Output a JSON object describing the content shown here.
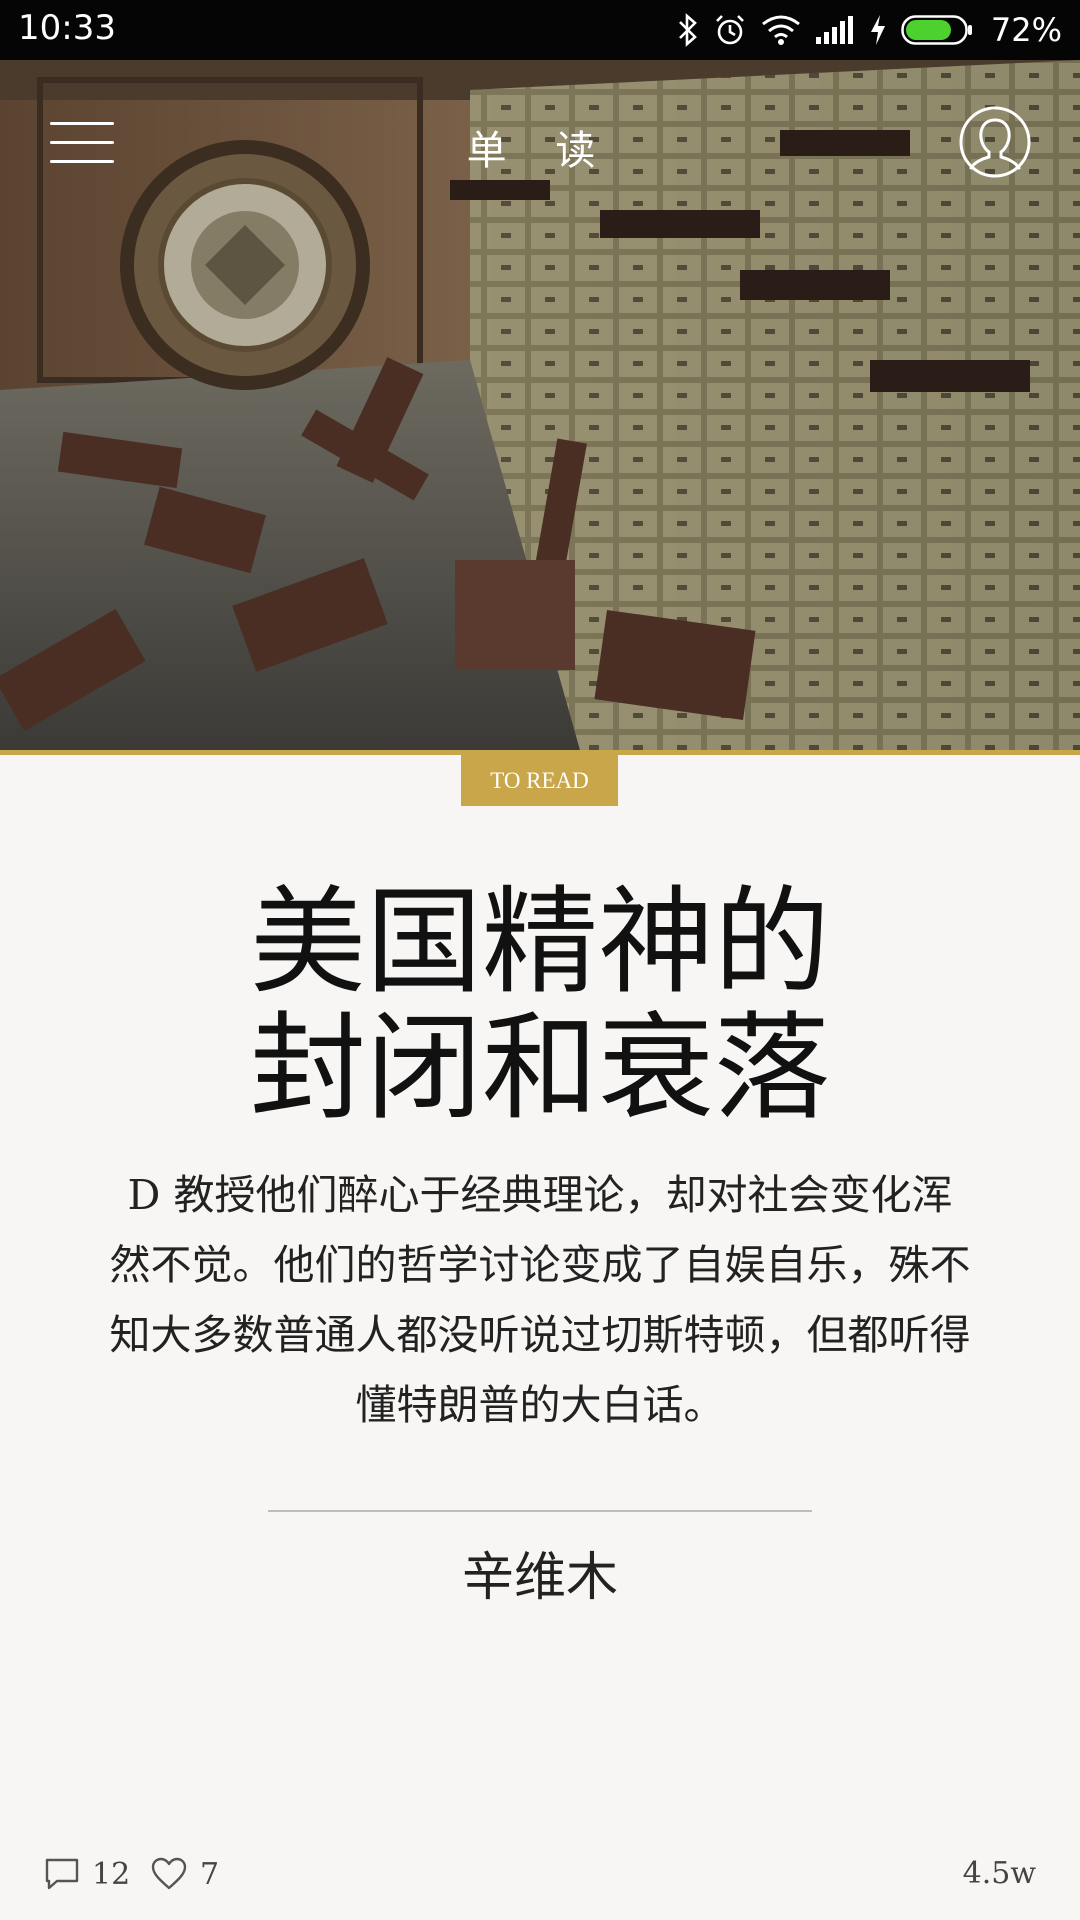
{
  "status_bar": {
    "time": "10:33",
    "battery": "72%",
    "icons": [
      "bluetooth-icon",
      "alarm-icon",
      "wifi-icon",
      "signal-icon",
      "charging-icon",
      "battery-icon"
    ]
  },
  "header": {
    "brand": "单 读",
    "menu_icon": "hamburger-menu-icon",
    "profile_icon": "user-profile-icon"
  },
  "article": {
    "tag": "TO READ",
    "title_lines": [
      "美国精神的",
      "封闭和衰落"
    ],
    "excerpt": "D 教授他们醉心于经典理论，却对社会变化浑然不觉。他们的哲学讨论变成了自娱自乐，殊不知大多数普通人都没听说过切斯特顿，但都听得懂特朗普的大白话。",
    "author": "辛维木"
  },
  "footer": {
    "comments": "12",
    "likes": "7",
    "word_count": "4.5w"
  },
  "colors": {
    "accent": "#c9a64a",
    "background": "#f7f6f4",
    "status_bar": "#050505"
  }
}
